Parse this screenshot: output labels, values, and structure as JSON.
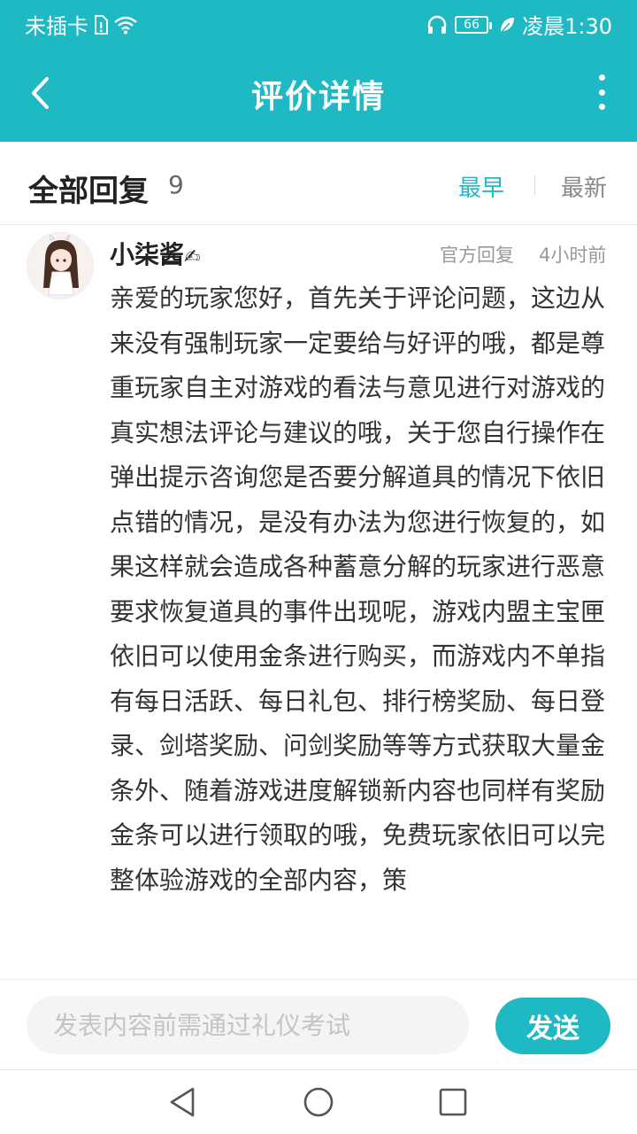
{
  "status_bar": {
    "carrier": "未插卡",
    "battery": "66",
    "time": "凌晨1:30"
  },
  "header": {
    "title": "评价详情"
  },
  "replies": {
    "title": "全部回复",
    "count": "9",
    "sort_earliest": "最早",
    "sort_latest": "最新"
  },
  "comment": {
    "username": "小柒酱",
    "official_label": "官方回复",
    "time": "4小时前",
    "body": "亲爱的玩家您好，首先关于评论问题，这边从来没有强制玩家一定要给与好评的哦，都是尊重玩家自主对游戏的看法与意见进行对游戏的真实想法评论与建议的哦，关于您自行操作在弹出提示咨询您是否要分解道具的情况下依旧点错的情况，是没有办法为您进行恢复的，如果这样就会造成各种蓄意分解的玩家进行恶意要求恢复道具的事件出现呢，游戏内盟主宝匣依旧可以使用金条进行购买，而游戏内不单指有每日活跃、每日礼包、排行榜奖励、每日登录、剑塔奖励、问剑奖励等等方式获取大量金条外、随着游戏进度解锁新内容也同样有奖励金条可以进行领取的哦，免费玩家依旧可以完整体验游戏的全部内容，策"
  },
  "input_bar": {
    "placeholder": "发表内容前需通过礼仪考试",
    "send_label": "发送"
  },
  "colors": {
    "accent": "#1fb9c3"
  },
  "icons": [
    "sim-icon",
    "wifi-icon",
    "headphones-icon",
    "leaf-icon",
    "back-icon",
    "more-icon",
    "nav-back-icon",
    "nav-home-icon",
    "nav-recents-icon"
  ]
}
